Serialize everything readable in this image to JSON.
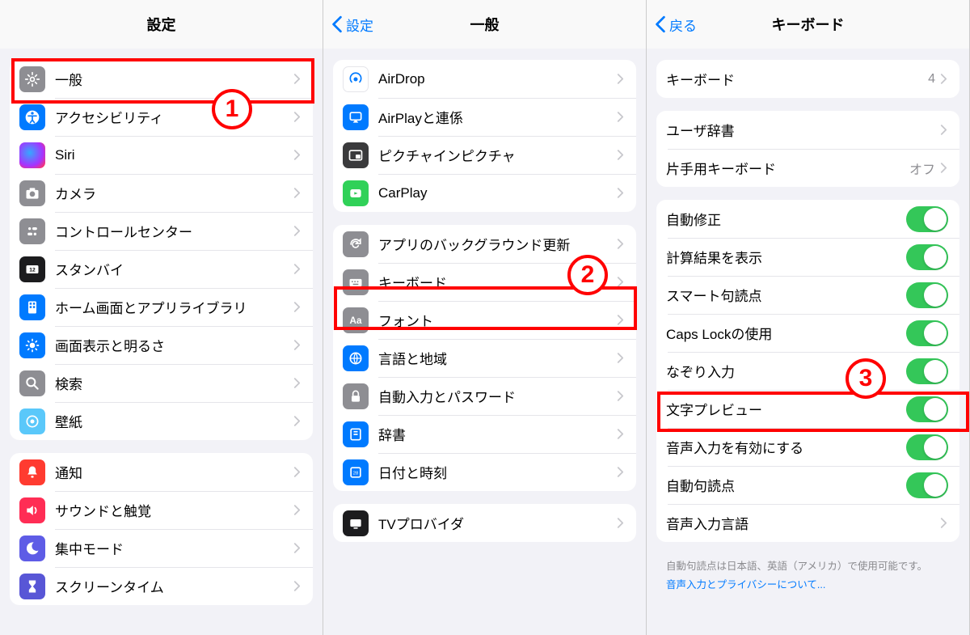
{
  "annotate": {
    "n1": "1",
    "n2": "2",
    "n3": "3"
  },
  "pane1": {
    "title": "設定",
    "groupA": [
      {
        "label": "一般"
      },
      {
        "label": "アクセシビリティ"
      },
      {
        "label": "Siri"
      },
      {
        "label": "カメラ"
      },
      {
        "label": "コントロールセンター"
      },
      {
        "label": "スタンバイ"
      },
      {
        "label": "ホーム画面とアプリライブラリ"
      },
      {
        "label": "画面表示と明るさ"
      },
      {
        "label": "検索"
      },
      {
        "label": "壁紙"
      }
    ],
    "groupB": [
      {
        "label": "通知"
      },
      {
        "label": "サウンドと触覚"
      },
      {
        "label": "集中モード"
      },
      {
        "label": "スクリーンタイム"
      }
    ]
  },
  "pane2": {
    "title": "一般",
    "back": "設定",
    "groupA": [
      {
        "label": "AirDrop"
      },
      {
        "label": "AirPlayと連係"
      },
      {
        "label": "ピクチャインピクチャ"
      },
      {
        "label": "CarPlay"
      }
    ],
    "groupB": [
      {
        "label": "アプリのバックグラウンド更新"
      },
      {
        "label": "キーボード"
      },
      {
        "label": "フォント"
      },
      {
        "label": "言語と地域"
      },
      {
        "label": "自動入力とパスワード"
      },
      {
        "label": "辞書"
      },
      {
        "label": "日付と時刻"
      }
    ],
    "groupC": [
      {
        "label": "TVプロバイダ"
      }
    ]
  },
  "pane3": {
    "title": "キーボード",
    "back": "戻る",
    "groupA": [
      {
        "label": "キーボード",
        "value": "4"
      }
    ],
    "groupB": [
      {
        "label": "ユーザ辞書"
      },
      {
        "label": "片手用キーボード",
        "value": "オフ"
      }
    ],
    "groupC": [
      {
        "label": "自動修正"
      },
      {
        "label": "計算結果を表示"
      },
      {
        "label": "スマート句読点"
      },
      {
        "label": "Caps Lockの使用"
      },
      {
        "label": "なぞり入力"
      },
      {
        "label": "文字プレビュー"
      },
      {
        "label": "音声入力を有効にする"
      },
      {
        "label": "自動句読点"
      },
      {
        "label": "音声入力言語"
      }
    ],
    "footer_note": "自動句読点は日本語、英語（アメリカ）で使用可能です。",
    "footer_link": "音声入力とプライバシーについて..."
  }
}
